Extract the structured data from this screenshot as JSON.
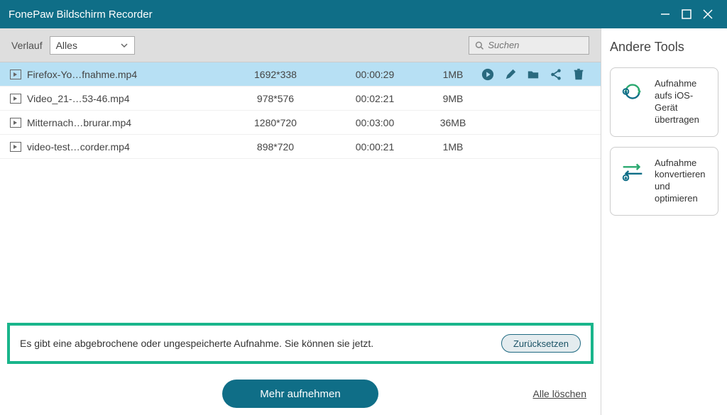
{
  "window": {
    "title": "FonePaw Bildschirm Recorder"
  },
  "toolbar": {
    "history_label": "Verlauf",
    "filter_selected": "Alles",
    "search_placeholder": "Suchen"
  },
  "recordings": [
    {
      "name": "Firefox-Yo…fnahme.mp4",
      "resolution": "1692*338",
      "duration": "00:00:29",
      "size": "1MB",
      "selected": true
    },
    {
      "name": "Video_21-…53-46.mp4",
      "resolution": "978*576",
      "duration": "00:02:21",
      "size": "9MB",
      "selected": false
    },
    {
      "name": "Mitternach…brurar.mp4",
      "resolution": "1280*720",
      "duration": "00:03:00",
      "size": "36MB",
      "selected": false
    },
    {
      "name": "video-test…corder.mp4",
      "resolution": "898*720",
      "duration": "00:00:21",
      "size": "1MB",
      "selected": false
    }
  ],
  "banner": {
    "text": "Es gibt eine abgebrochene oder ungespeicherte Aufnahme. Sie können sie jetzt.",
    "reset_label": "Zurücksetzen"
  },
  "bottom": {
    "record_label": "Mehr aufnehmen",
    "delete_all_label": "Alle löschen"
  },
  "sidebar": {
    "title": "Andere Tools",
    "tools": [
      {
        "label": "Aufnahme aufs iOS-Gerät übertragen"
      },
      {
        "label": "Aufnahme konvertieren und optimieren"
      }
    ]
  }
}
